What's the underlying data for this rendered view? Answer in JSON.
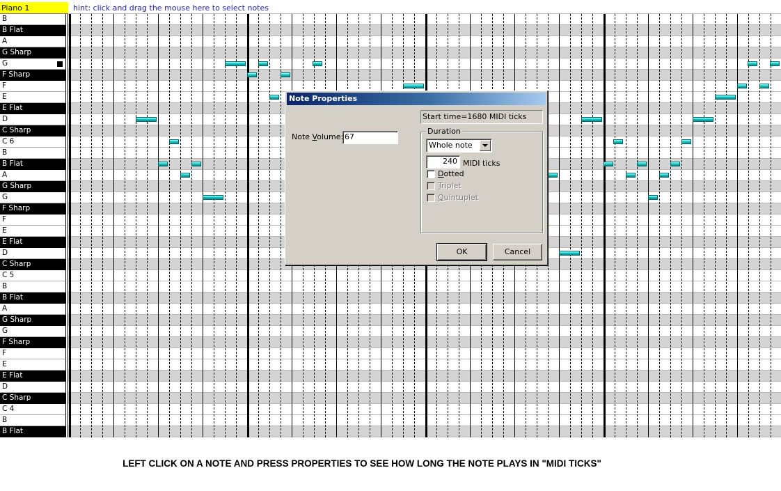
{
  "track": {
    "name": "Piano 1"
  },
  "hint": "hint:  click and drag the mouse here to select notes",
  "keys": [
    {
      "label": "B",
      "type": "white"
    },
    {
      "label": "B Flat",
      "type": "black"
    },
    {
      "label": "A",
      "type": "white"
    },
    {
      "label": "G Sharp",
      "type": "black"
    },
    {
      "label": "G",
      "type": "white",
      "marker": true
    },
    {
      "label": "F Sharp",
      "type": "black"
    },
    {
      "label": "F",
      "type": "white"
    },
    {
      "label": "E",
      "type": "white"
    },
    {
      "label": "E Flat",
      "type": "black"
    },
    {
      "label": "D",
      "type": "white"
    },
    {
      "label": "C Sharp",
      "type": "black"
    },
    {
      "label": "C 6",
      "type": "white"
    },
    {
      "label": "B",
      "type": "white"
    },
    {
      "label": "B Flat",
      "type": "black"
    },
    {
      "label": "A",
      "type": "white"
    },
    {
      "label": "G Sharp",
      "type": "black"
    },
    {
      "label": "G",
      "type": "white"
    },
    {
      "label": "F Sharp",
      "type": "black"
    },
    {
      "label": "F",
      "type": "white"
    },
    {
      "label": "E",
      "type": "white"
    },
    {
      "label": "E Flat",
      "type": "black"
    },
    {
      "label": "D",
      "type": "white"
    },
    {
      "label": "C Sharp",
      "type": "black"
    },
    {
      "label": "C 5",
      "type": "white"
    },
    {
      "label": "B",
      "type": "white"
    },
    {
      "label": "B Flat",
      "type": "black"
    },
    {
      "label": "A",
      "type": "white"
    },
    {
      "label": "G Sharp",
      "type": "black"
    },
    {
      "label": "G",
      "type": "white"
    },
    {
      "label": "F Sharp",
      "type": "black"
    },
    {
      "label": "F",
      "type": "white"
    },
    {
      "label": "E",
      "type": "white"
    },
    {
      "label": "E Flat",
      "type": "black"
    },
    {
      "label": "D",
      "type": "white"
    },
    {
      "label": "C Sharp",
      "type": "black"
    },
    {
      "label": "C 4",
      "type": "white"
    },
    {
      "label": "B",
      "type": "white"
    },
    {
      "label": "B Flat",
      "type": "black"
    }
  ],
  "dialog": {
    "title": "Note Properties",
    "start_time": "Start time=1680 MIDI ticks",
    "volume_label": "Note Volume:",
    "volume_value": "67",
    "duration_label": "Duration",
    "duration_selected": "Whole note",
    "ticks_value": "240",
    "ticks_label": "MIDI ticks",
    "dotted_label": "Dotted",
    "triplet_label": "Triplet",
    "quintuplet_label": "Quintuplet",
    "ok_label": "OK",
    "cancel_label": "Cancel"
  },
  "instruction": "LEFT CLICK ON A NOTE AND PRESS PROPERTIES TO SEE HOW LONG THE NOTE PLAYS IN \"MIDI TICKS\"",
  "colors": {
    "track_label_bg": "#ffff00",
    "hint_text": "#2020c8",
    "note": "#1ec8c8",
    "dialog_title": "#0a246a"
  }
}
